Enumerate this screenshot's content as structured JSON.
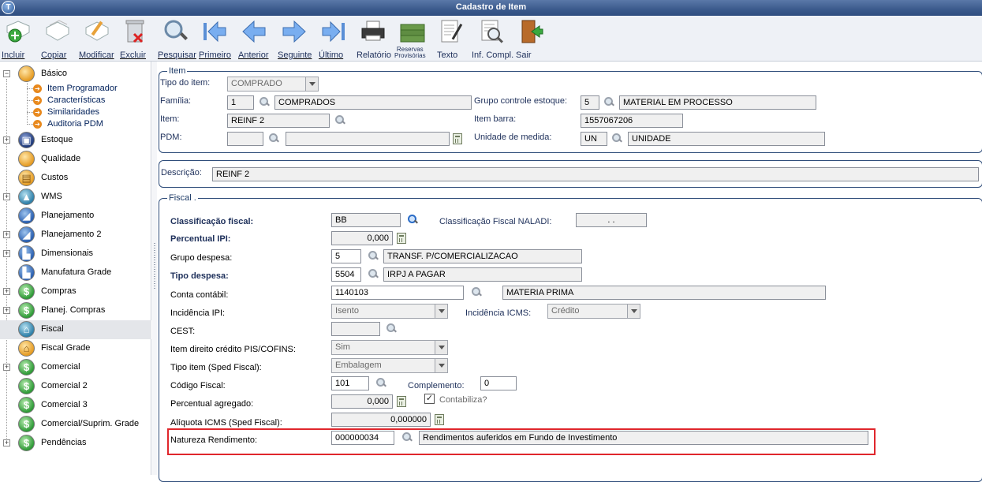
{
  "window": {
    "title": "Cadastro de Item",
    "logo": "T"
  },
  "toolbar": [
    {
      "label": "Incluir",
      "icon": "add-icon"
    },
    {
      "label": "Copiar",
      "icon": "copy-icon"
    },
    {
      "label": "Modificar",
      "icon": "edit-icon"
    },
    {
      "label": "Excluir",
      "icon": "trash-icon"
    },
    {
      "label": "Pesquisar",
      "icon": "search-icon"
    },
    {
      "label": "Primeiro",
      "icon": "first-arrow-icon"
    },
    {
      "label": "Anterior",
      "icon": "previous-arrow-icon"
    },
    {
      "label": "Seguinte",
      "icon": "next-arrow-icon"
    },
    {
      "label": "Último",
      "icon": "last-arrow-icon"
    },
    {
      "label": "Relatório",
      "icon": "printer-icon"
    },
    {
      "label": "Reservas",
      "label2": "Provisórias",
      "icon": "money-stack-icon"
    },
    {
      "label": "Texto",
      "icon": "document-pen-icon"
    },
    {
      "label": "Inf. Compl.",
      "icon": "info-search-icon"
    },
    {
      "label": "Sair",
      "icon": "exit-door-icon"
    }
  ],
  "tree": {
    "basico": "Básico",
    "children": [
      "Item Programador",
      "Características",
      "Similaridades",
      "Auditoria PDM"
    ],
    "items": [
      "Estoque",
      "Qualidade",
      "Custos",
      "WMS",
      "Planejamento",
      "Planejamento 2",
      "Dimensionais",
      "Manufatura Grade",
      "Compras",
      "Planej. Compras",
      "Fiscal",
      "Fiscal Grade",
      "Comercial",
      "Comercial 2",
      "Comercial 3",
      "Comercial/Suprim. Grade",
      "Pendências"
    ],
    "expander_plus": "+",
    "expander_minus": "−",
    "child_arrow": "➔",
    "selected": "Fiscal"
  },
  "item": {
    "legend": "Item",
    "tipo_label": "Tipo do item:",
    "tipo_value": "COMPRADO",
    "familia_label": "Família:",
    "familia_code": "1",
    "familia_desc": "COMPRADOS",
    "grupo_label": "Grupo controle estoque:",
    "grupo_code": "5",
    "grupo_desc": "MATERIAL EM PROCESSO",
    "item_label": "Item:",
    "item_value": "REINF 2",
    "barra_label": "Item barra:",
    "barra_value": "1557067206",
    "pdm_label": "PDM:",
    "pdm_code": "",
    "pdm_desc": "",
    "unidade_label": "Unidade de medida:",
    "unidade_code": "UN",
    "unidade_desc": "UNIDADE"
  },
  "descricao": {
    "label": "Descrição:",
    "value": "REINF 2"
  },
  "fiscal": {
    "legend": "Fiscal .",
    "classificacao_label": "Classificação fiscal:",
    "classificacao_value": "BB",
    "naladi_label": "Classificação Fiscal NALADI:",
    "naladi_value": ". .",
    "ipi_label": "Percentual IPI:",
    "ipi_value": "0,000",
    "grupo_despesa_label": "Grupo despesa:",
    "grupo_despesa_code": "5",
    "grupo_despesa_desc": "TRANSF. P/COMERCIALIZACAO",
    "tipo_despesa_label": "Tipo despesa:",
    "tipo_despesa_code": "5504",
    "tipo_despesa_desc": "IRPJ A PAGAR",
    "conta_label": "Conta contábil:",
    "conta_code": "1140103",
    "conta_desc": "MATERIA PRIMA",
    "inc_ipi_label": "Incidência IPI:",
    "inc_ipi_value": "Isento",
    "inc_icms_label": "Incidência ICMS:",
    "inc_icms_value": "Crédito",
    "cest_label": "CEST:",
    "cest_value": "",
    "pis_label": "Item direito crédito PIS/COFINS:",
    "pis_value": "Sim",
    "sped_label": "Tipo item (Sped Fiscal):",
    "sped_value": "Embalagem",
    "codigo_label": "Código Fiscal:",
    "codigo_value": "101",
    "complemento_label": "Complemento:",
    "complemento_value": "0",
    "agregado_label": "Percentual agregado:",
    "agregado_value": "0,000",
    "contabiliza_label": "Contabiliza?",
    "contabiliza_checked": "✓",
    "aliquota_label": "Alíquota ICMS (Sped Fiscal):",
    "aliquota_value": "0,000000",
    "natureza_label": "Natureza Rendimento:",
    "natureza_code": "000000034",
    "natureza_desc": "Rendimentos auferidos em Fundo de Investimento"
  },
  "colors": {
    "highlight": "#e0262c",
    "titlebar": "#3b5a8c",
    "border": "#2f4d7a"
  }
}
